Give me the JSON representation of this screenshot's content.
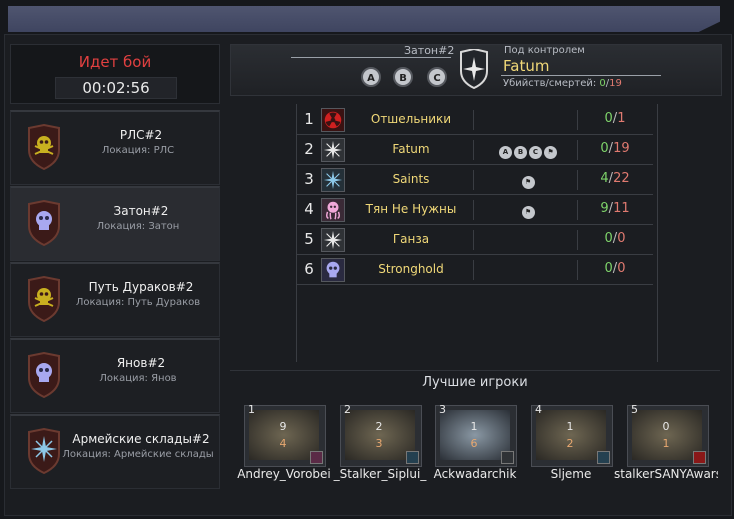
{
  "battle": {
    "title": "Идет бой",
    "timer": "00:02:56"
  },
  "zones": [
    {
      "name": "РЛС#2",
      "location": "Локация: РЛС",
      "icon": "yellow-skull-shield-icon"
    },
    {
      "name": "Затон#2",
      "location": "Локация: Затон",
      "icon": "purple-skull-shield-icon"
    },
    {
      "name": "Путь Дураков#2",
      "location": "Локация: Путь Дураков",
      "icon": "yellow-skull-shield-icon"
    },
    {
      "name": "Янов#2",
      "location": "Локация: Янов",
      "icon": "purple-skull-shield-icon"
    },
    {
      "name": "Армейские склады#2",
      "location": "Локация: Армейские склады",
      "icon": "compass-star-shield-icon"
    }
  ],
  "header": {
    "zone_label": "Затон#2",
    "points": [
      "A",
      "B",
      "C"
    ],
    "under_control_label": "Под контролем",
    "controller": "Fatum",
    "kd_label": "Убийств/смертей:",
    "kills": "0",
    "slash": "/",
    "deaths": "19"
  },
  "groups": [
    {
      "rank": "1",
      "name": "Отшельники",
      "kills": "0",
      "deaths": "1",
      "points": [],
      "icon": "radiation-icon"
    },
    {
      "rank": "2",
      "name": "Fatum",
      "kills": "0",
      "deaths": "19",
      "points": [
        "A",
        "B",
        "C",
        "flag"
      ],
      "icon": "compass-star-icon"
    },
    {
      "rank": "3",
      "name": "Saints",
      "kills": "4",
      "deaths": "22",
      "points": [
        "flag"
      ],
      "icon": "compass-star-icon"
    },
    {
      "rank": "4",
      "name": "Тян Не Нужны",
      "kills": "9",
      "deaths": "11",
      "points": [
        "flag"
      ],
      "icon": "octopus-icon"
    },
    {
      "rank": "5",
      "name": "Ганза",
      "kills": "0",
      "deaths": "0",
      "points": [],
      "icon": "compass-star-icon"
    },
    {
      "rank": "6",
      "name": "Stronghold",
      "kills": "0",
      "deaths": "0",
      "points": [],
      "icon": "skull-icon"
    }
  ],
  "best_players": {
    "title": "Лучшие игроки",
    "players": [
      {
        "rank": "1",
        "kills": "9",
        "deaths": "4",
        "name": "Andrey_Vorobei"
      },
      {
        "rank": "2",
        "kills": "2",
        "deaths": "3",
        "name": "_Stalker_Siplui_"
      },
      {
        "rank": "3",
        "kills": "1",
        "deaths": "6",
        "name": "Ackwadarchik"
      },
      {
        "rank": "4",
        "kills": "1",
        "deaths": "2",
        "name": "Sljeme"
      },
      {
        "rank": "5",
        "kills": "0",
        "deaths": "1",
        "name": "stalkerSANYAwars"
      }
    ]
  },
  "colors": {
    "accent_gold": "#f0d878",
    "battle_red": "#e04040",
    "kill_green": "#7ed36a",
    "death_red": "#e07a70"
  }
}
